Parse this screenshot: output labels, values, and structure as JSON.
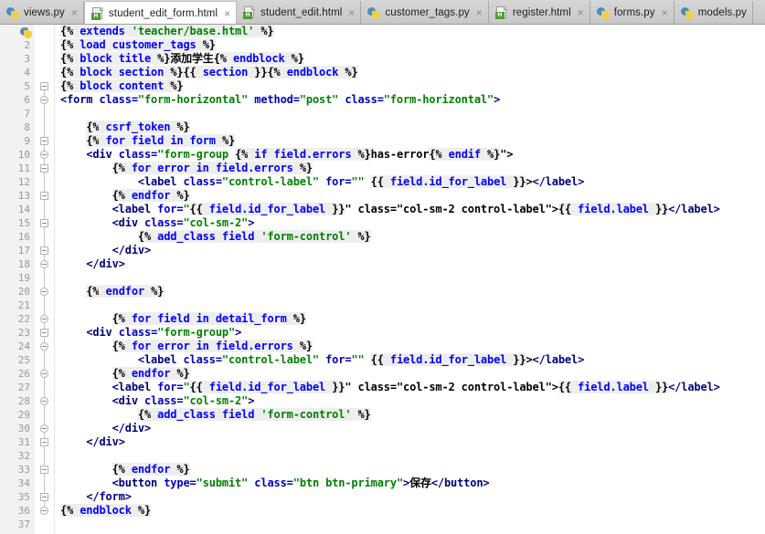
{
  "window": {
    "app": "PyCharm Editor",
    "active_file": "student_edit_form.html"
  },
  "tabs": [
    {
      "label": "views.py",
      "icon": "python-file-icon",
      "active": false,
      "close": "×"
    },
    {
      "label": "student_edit_form.html",
      "icon": "html-file-icon",
      "active": true,
      "close": "×"
    },
    {
      "label": "student_edit.html",
      "icon": "html-file-icon",
      "active": false,
      "close": "×"
    },
    {
      "label": "customer_tags.py",
      "icon": "python-file-icon",
      "active": false,
      "close": "×"
    },
    {
      "label": "register.html",
      "icon": "html-file-icon",
      "active": false,
      "close": "×"
    },
    {
      "label": "forms.py",
      "icon": "python-file-icon",
      "active": false,
      "close": "×"
    },
    {
      "label": "models.py",
      "icon": "python-file-icon",
      "active": false,
      "close": ""
    }
  ],
  "colors": {
    "tag": "#000080",
    "attribute": "#0000c0",
    "string": "#008000",
    "django_tag_bg": "#eeeeee",
    "django_keyword": "#0000ff",
    "gutter_bg": "#f2f2f2",
    "line_number": "#999999",
    "editor_bg": "#ffffff",
    "tabbar_bg": "#c8c8c8"
  },
  "editor": {
    "line_numbers": [
      "1",
      "2",
      "3",
      "4",
      "5",
      "6",
      "7",
      "8",
      "9",
      "10",
      "11",
      "12",
      "13",
      "14",
      "15",
      "16",
      "17",
      "18",
      "19",
      "20",
      "21",
      "22",
      "23",
      "24",
      "25",
      "26",
      "27",
      "28",
      "29",
      "30",
      "31",
      "32",
      "33",
      "34",
      "35",
      "36",
      "37"
    ],
    "lines": [
      {
        "n": 1,
        "text": "{% extends 'teacher/base.html' %}"
      },
      {
        "n": 2,
        "text": "{% load customer_tags %}"
      },
      {
        "n": 3,
        "text": "{% block title %}添加学生{% endblock %}"
      },
      {
        "n": 4,
        "text": "{% block section %}{{ section }}{% endblock %}"
      },
      {
        "n": 5,
        "text": "{% block content %}"
      },
      {
        "n": 6,
        "text": "<form class=\"form-horizontal\" method=\"post\" class=\"form-horizontal\">"
      },
      {
        "n": 7,
        "text": ""
      },
      {
        "n": 8,
        "text": "    {% csrf_token %}"
      },
      {
        "n": 9,
        "text": "    {% for field in form %}"
      },
      {
        "n": 10,
        "text": "    <div class=\"form-group {% if field.errors %}has-error{% endif %}\">"
      },
      {
        "n": 11,
        "text": "        {% for error in field.errors %}"
      },
      {
        "n": 12,
        "text": "            <label class=\"control-label\" for=\"\" {{ field.id_for_label }}></label>"
      },
      {
        "n": 13,
        "text": "        {% endfor %}"
      },
      {
        "n": 14,
        "text": "        <label for=\"{{ field.id_for_label }}\" class=\"col-sm-2 control-label\">{{ field.label }}</label>"
      },
      {
        "n": 15,
        "text": "        <div class=\"col-sm-2\">"
      },
      {
        "n": 16,
        "text": "            {% add_class field 'form-control' %}"
      },
      {
        "n": 17,
        "text": "        </div>"
      },
      {
        "n": 18,
        "text": "    </div>"
      },
      {
        "n": 19,
        "text": ""
      },
      {
        "n": 20,
        "text": "    {% endfor %}"
      },
      {
        "n": 21,
        "text": ""
      },
      {
        "n": 22,
        "text": "        {% for field in detail_form %}"
      },
      {
        "n": 23,
        "text": "    <div class=\"form-group\">"
      },
      {
        "n": 24,
        "text": "        {% for error in field.errors %}"
      },
      {
        "n": 25,
        "text": "            <label class=\"control-label\" for=\"\" {{ field.id_for_label }}></label>"
      },
      {
        "n": 26,
        "text": "        {% endfor %}"
      },
      {
        "n": 27,
        "text": "        <label for=\"{{ field.id_for_label }}\" class=\"col-sm-2 control-label\">{{ field.label }}</label>"
      },
      {
        "n": 28,
        "text": "        <div class=\"col-sm-2\">"
      },
      {
        "n": 29,
        "text": "            {% add_class field 'form-control' %}"
      },
      {
        "n": 30,
        "text": "        </div>"
      },
      {
        "n": 31,
        "text": "    </div>"
      },
      {
        "n": 32,
        "text": ""
      },
      {
        "n": 33,
        "text": "        {% endfor %}"
      },
      {
        "n": 34,
        "text": "        <button type=\"submit\" class=\"btn btn-primary\">保存</button>"
      },
      {
        "n": 35,
        "text": "    </form>"
      },
      {
        "n": 36,
        "text": "{% endblock %}"
      },
      {
        "n": 37,
        "text": ""
      }
    ],
    "fold_marker_lines": [
      5,
      6,
      9,
      10,
      11,
      13,
      15,
      17,
      18,
      20,
      22,
      23,
      24,
      26,
      28,
      30,
      31,
      33,
      35,
      36
    ]
  }
}
